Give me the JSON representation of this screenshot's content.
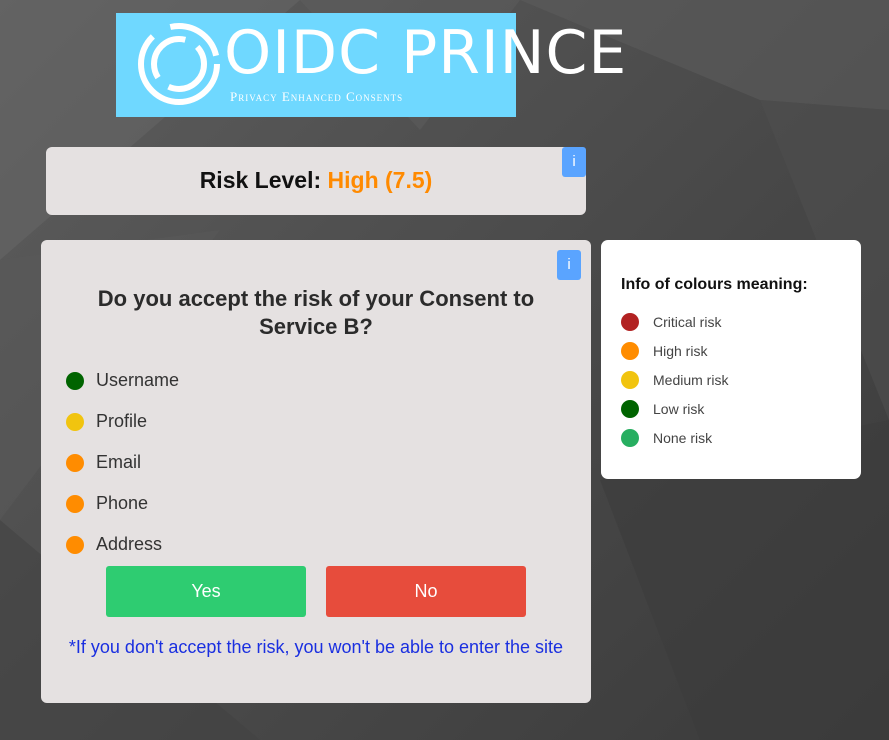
{
  "logo": {
    "title": "OIDC PRINCE",
    "subtitle": "Privacy Enhanced Consents",
    "background": "#6fd8ff"
  },
  "risk": {
    "label": "Risk Level:",
    "value": "High (7.5)",
    "value_color": "#ff8a00",
    "info_label": "i"
  },
  "consent": {
    "info_label": "i",
    "question": "Do you accept the risk of your Consent to Service B?",
    "attributes": [
      {
        "label": "Username",
        "color": "#006400"
      },
      {
        "label": "Profile",
        "color": "#f1c40f"
      },
      {
        "label": "Email",
        "color": "#ff8c00"
      },
      {
        "label": "Phone",
        "color": "#ff8c00"
      },
      {
        "label": "Address",
        "color": "#ff8c00"
      }
    ],
    "yes_label": "Yes",
    "no_label": "No",
    "note": "*If you don't accept the risk, you won't be able to enter the site"
  },
  "legend": {
    "title": "Info of colours meaning:",
    "items": [
      {
        "label": "Critical risk",
        "color": "#b22222"
      },
      {
        "label": "High risk",
        "color": "#ff8c00"
      },
      {
        "label": "Medium risk",
        "color": "#f1c40f"
      },
      {
        "label": "Low risk",
        "color": "#006400"
      },
      {
        "label": "None risk",
        "color": "#27ae60"
      }
    ]
  },
  "colors": {
    "yes_button": "#2ecc71",
    "no_button": "#e74c3c",
    "info_button": "#5aa4ff",
    "note_text": "#1a2fe0"
  }
}
